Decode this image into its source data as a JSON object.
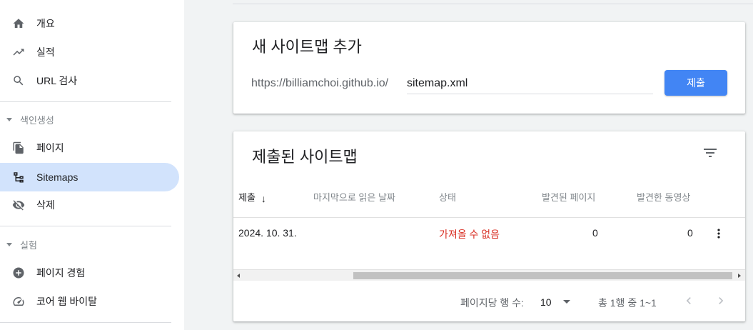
{
  "sidebar": {
    "items": [
      {
        "label": "개요",
        "icon": "home-icon"
      },
      {
        "label": "실적",
        "icon": "trending-up-icon"
      },
      {
        "label": "URL 검사",
        "icon": "search-icon"
      }
    ],
    "sections": [
      {
        "title": "색인생성",
        "items": [
          {
            "label": "페이지",
            "icon": "file-copy-icon"
          },
          {
            "label": "Sitemaps",
            "icon": "sitemap-icon",
            "active": true
          },
          {
            "label": "삭제",
            "icon": "visibility-off-icon"
          }
        ]
      },
      {
        "title": "실험",
        "items": [
          {
            "label": "페이지 경험",
            "icon": "add-circle-icon"
          },
          {
            "label": "코어 웹 바이탈",
            "icon": "speed-gauge-icon"
          }
        ]
      }
    ]
  },
  "add_sitemap": {
    "title": "새 사이트맵 추가",
    "url_prefix": "https://billiamchoi.github.io/",
    "input_value": "sitemap.xml",
    "submit_label": "제출"
  },
  "submitted": {
    "title": "제출된 사이트맵",
    "columns": [
      "제출",
      "마지막으로 읽은 날짜",
      "상태",
      "발견된 페이지",
      "발견한 동영상"
    ],
    "sort_arrow": "↓",
    "rows": [
      {
        "submitted": "2024. 10. 31.",
        "last_read": "",
        "status": "가져올 수 없음",
        "pages": "0",
        "videos": "0"
      }
    ],
    "pagination": {
      "rows_per_page_label": "페이지당 행 수:",
      "rows_per_page_value": "10",
      "range_text": "총 1행 중 1~1"
    }
  },
  "colors": {
    "accent": "#4285f4",
    "active_nav": "#d2e3fc",
    "error": "#d93025"
  }
}
